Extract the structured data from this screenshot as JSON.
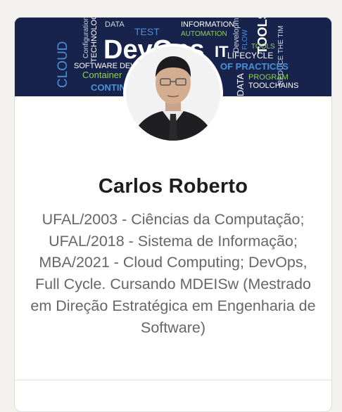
{
  "profile": {
    "name": "Carlos Roberto",
    "headline": "UFAL/2003 - Ciências da Computação; UFAL/2018 - Sistema de Informação; MBA/2021 - Cloud Computing; DevOps, Full Cycle. Cursando MDEISw (Mestrado em Direção Estratégica em Engenharia de Software)"
  },
  "banner": {
    "words": {
      "devops": "DevOps",
      "it": "IT",
      "cloud": "CLOUD",
      "software_dev": "SOFTWARE DEV",
      "container": "Container",
      "continuous": "CONTIN",
      "information": "INFORMATION",
      "automation": "AUTOMATION",
      "test": "TEST",
      "tools": "TOOLS",
      "lifecycle": "LIFECYCLE",
      "of_practices": "OF PRACTICES",
      "program": "PROGRAM",
      "toolchains": "TOOLCHAINS",
      "data": "DATA",
      "technology": "TECHNOLOGY",
      "configuration": "Configuration",
      "development": "Development",
      "flow": "FLOW",
      "reduce": "REDUCE THE TIM"
    }
  },
  "colors": {
    "banner_bg": "#17234a",
    "name_text": "#1d1d1d",
    "headline_text": "#666666"
  }
}
